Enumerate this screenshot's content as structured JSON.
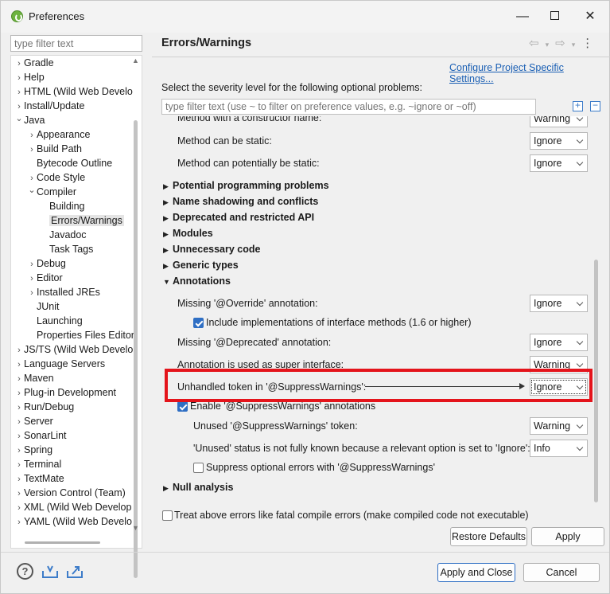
{
  "window": {
    "title": "Preferences"
  },
  "left": {
    "filter_placeholder": "type filter text",
    "tree": [
      {
        "label": "Gradle",
        "chev": "›",
        "indent": 0
      },
      {
        "label": "Help",
        "chev": "›",
        "indent": 0
      },
      {
        "label": "HTML (Wild Web Develo",
        "chev": "›",
        "indent": 0
      },
      {
        "label": "Install/Update",
        "chev": "›",
        "indent": 0
      },
      {
        "label": "Java",
        "chev": "⌄",
        "indent": 0
      },
      {
        "label": "Appearance",
        "chev": "›",
        "indent": 1
      },
      {
        "label": "Build Path",
        "chev": "›",
        "indent": 1
      },
      {
        "label": "Bytecode Outline",
        "chev": "",
        "indent": 1
      },
      {
        "label": "Code Style",
        "chev": "›",
        "indent": 1
      },
      {
        "label": "Compiler",
        "chev": "⌄",
        "indent": 1
      },
      {
        "label": "Building",
        "chev": "",
        "indent": 2
      },
      {
        "label": "Errors/Warnings",
        "chev": "",
        "indent": 2,
        "selected": true
      },
      {
        "label": "Javadoc",
        "chev": "",
        "indent": 2
      },
      {
        "label": "Task Tags",
        "chev": "",
        "indent": 2
      },
      {
        "label": "Debug",
        "chev": "›",
        "indent": 1
      },
      {
        "label": "Editor",
        "chev": "›",
        "indent": 1
      },
      {
        "label": "Installed JREs",
        "chev": "›",
        "indent": 1
      },
      {
        "label": "JUnit",
        "chev": "",
        "indent": 1
      },
      {
        "label": "Launching",
        "chev": "",
        "indent": 1
      },
      {
        "label": "Properties Files Editor",
        "chev": "",
        "indent": 1
      },
      {
        "label": "JS/TS (Wild Web Develo",
        "chev": "›",
        "indent": 0
      },
      {
        "label": "Language Servers",
        "chev": "›",
        "indent": 0
      },
      {
        "label": "Maven",
        "chev": "›",
        "indent": 0
      },
      {
        "label": "Plug-in Development",
        "chev": "›",
        "indent": 0
      },
      {
        "label": "Run/Debug",
        "chev": "›",
        "indent": 0
      },
      {
        "label": "Server",
        "chev": "›",
        "indent": 0
      },
      {
        "label": "SonarLint",
        "chev": "›",
        "indent": 0
      },
      {
        "label": "Spring",
        "chev": "›",
        "indent": 0
      },
      {
        "label": "Terminal",
        "chev": "›",
        "indent": 0
      },
      {
        "label": "TextMate",
        "chev": "›",
        "indent": 0
      },
      {
        "label": "Version Control (Team)",
        "chev": "›",
        "indent": 0
      },
      {
        "label": "XML (Wild Web Develop",
        "chev": "›",
        "indent": 0
      },
      {
        "label": "YAML (Wild Web Develo",
        "chev": "›",
        "indent": 0
      }
    ]
  },
  "right": {
    "title": "Errors/Warnings",
    "config_link": "Configure Project Specific Settings...",
    "severity_label": "Select the severity level for the following optional problems:",
    "filter_placeholder": "type filter text (use ~ to filter on preference values, e.g. ~ignore or ~off)",
    "rows_top": [
      {
        "label": "Method with a constructor name:",
        "value": "Warning"
      },
      {
        "label": "Method can be static:",
        "value": "Ignore"
      },
      {
        "label": "Method can potentially be static:",
        "value": "Ignore"
      }
    ],
    "sections": [
      "Potential programming problems",
      "Name shadowing and conflicts",
      "Deprecated and restricted API",
      "Modules",
      "Unnecessary code",
      "Generic types"
    ],
    "annotations": {
      "header": "Annotations",
      "missing_override": {
        "label": "Missing '@Override' annotation:",
        "value": "Ignore"
      },
      "include_impl": "Include implementations of interface methods (1.6 or higher)",
      "missing_deprecated": {
        "label": "Missing '@Deprecated' annotation:",
        "value": "Ignore"
      },
      "super_interface": {
        "label": "Annotation is used as super interface:",
        "value": "Warning"
      },
      "unhandled_token": {
        "label": "Unhandled token in '@SuppressWarnings':",
        "value": "Ignore"
      },
      "enable_suppress": "Enable '@SuppressWarnings' annotations",
      "unused_token": {
        "label": "Unused '@SuppressWarnings' token:",
        "value": "Warning"
      },
      "unused_status": {
        "label": "'Unused' status is not fully known because a relevant option is set to 'Ignore':",
        "value": "Info"
      },
      "suppress_optional": "Suppress optional errors with '@SuppressWarnings'"
    },
    "null_analysis": "Null analysis",
    "treat_fatal": "Treat above errors like fatal compile errors (make compiled code not executable)",
    "restore_defaults": "Restore Defaults",
    "apply": "Apply"
  },
  "footer": {
    "apply_close": "Apply and Close",
    "cancel": "Cancel"
  }
}
